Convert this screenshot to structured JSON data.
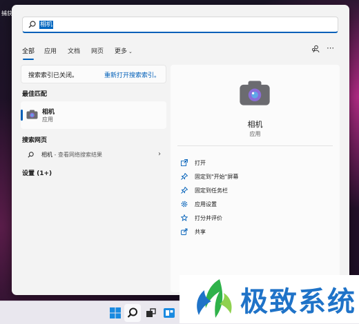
{
  "desktop": {
    "icon_label": "捕获"
  },
  "search": {
    "query": "相机"
  },
  "tabs": [
    {
      "label": "全部"
    },
    {
      "label": "应用"
    },
    {
      "label": "文档"
    },
    {
      "label": "网页"
    },
    {
      "label": "更多"
    }
  ],
  "indexing": {
    "message": "搜索索引已关闭。",
    "link": "重新打开搜索索引。"
  },
  "sections": {
    "best_match": "最佳匹配",
    "web": "搜索网页",
    "settings": "设置 (1+)"
  },
  "best_match": {
    "name": "相机",
    "type": "应用"
  },
  "web_result": {
    "term": "相机",
    "suffix": " - 查看网络搜索结果"
  },
  "detail": {
    "name": "相机",
    "type": "应用",
    "actions": [
      {
        "label": "打开",
        "icon": "open-icon"
      },
      {
        "label": "固定到\"开始\"屏幕",
        "icon": "pin-icon"
      },
      {
        "label": "固定到任务栏",
        "icon": "pin-icon"
      },
      {
        "label": "应用设置",
        "icon": "gear-icon"
      },
      {
        "label": "打分并评价",
        "icon": "star-icon"
      },
      {
        "label": "共享",
        "icon": "share-icon"
      }
    ]
  },
  "watermark": {
    "text": "极致系统"
  },
  "colors": {
    "accent": "#005fb8",
    "watermark": "#1f73c8"
  }
}
